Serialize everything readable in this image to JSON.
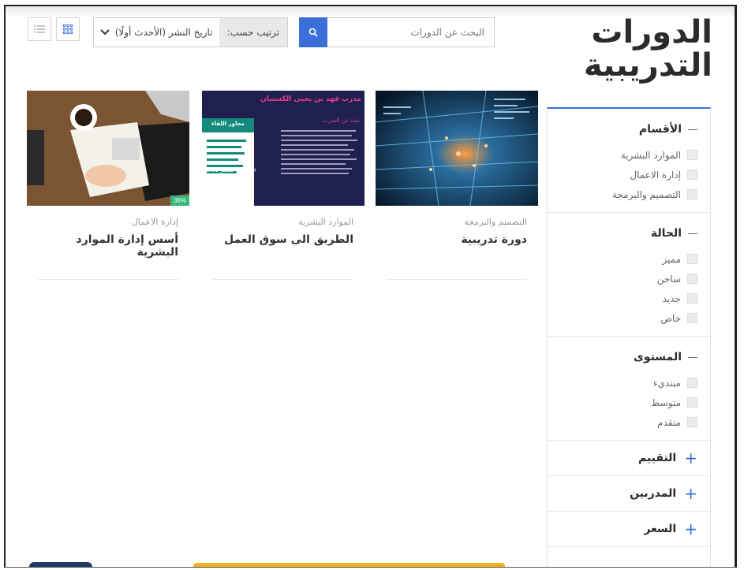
{
  "page": {
    "title": "الدورات التدريبية"
  },
  "toolbar": {
    "search_placeholder": "البحث عن الدورات",
    "sort_label": "ترتيب حسب:",
    "sort_value": "تاريخ النشر (الأحدث أولًا)",
    "view_grid_icon": "grid-icon",
    "view_list_icon": "list-icon"
  },
  "filters": {
    "categories": {
      "title": "الأقسام",
      "options": [
        "الموارد البشرية",
        "إدارة الاعمال",
        "التصميم والبرمجة"
      ]
    },
    "status": {
      "title": "الحالة",
      "options": [
        "مميز",
        "ساخن",
        "جديد",
        "خاص"
      ]
    },
    "level": {
      "title": "المستوى",
      "options": [
        "مبتديء",
        "متوسط",
        "متقدم"
      ]
    },
    "collapsed": [
      "التقييم",
      "المدربين",
      "السعر"
    ]
  },
  "courses": [
    {
      "category": "التصميم والبرمجة",
      "title": "دورة تدريبية"
    },
    {
      "category": "الموارد البشرية",
      "title": "الطريق الى سوق العمل"
    },
    {
      "category": "إدارة الاعمال",
      "title": "أسس إدارة الموارد البشرية",
      "progress": "36%"
    }
  ],
  "thumb2_text": {
    "banner": "مدرب فهد بن يحيى الكستبان",
    "heading": "محاور اللقاء",
    "subheading": "نبذة عن المدرب",
    "date": "السبت 17 سبتمبر 2022",
    "time": "7:00 م - 8:30 م"
  },
  "colors": {
    "accent": "#3a6fd8",
    "progress": "#36b97a"
  }
}
